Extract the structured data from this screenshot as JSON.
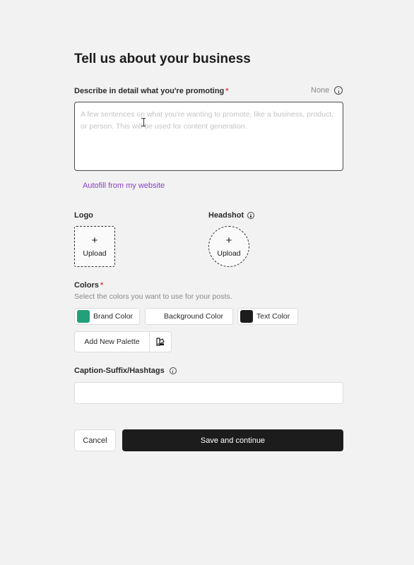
{
  "title": "Tell us about your business",
  "description": {
    "label": "Describe in detail what you're promoting",
    "required_mark": "*",
    "none_text": "None",
    "placeholder": "A few sentences on what you're wanting to promote, like a business, product, or person. This will be used for content generation.",
    "value": ""
  },
  "autofill_link": "Autofill from my website",
  "logo": {
    "label": "Logo",
    "upload_plus": "+",
    "upload_text": "Upload"
  },
  "headshot": {
    "label": "Headshot",
    "upload_plus": "+",
    "upload_text": "Upload"
  },
  "colors": {
    "label": "Colors",
    "required_mark": "*",
    "subtitle": "Select the colors you want to use for your posts.",
    "chips": [
      {
        "label": "Brand Color",
        "color": "#22a07a"
      },
      {
        "label": "Background Color",
        "color": "#ffffff"
      },
      {
        "label": "Text Color",
        "color": "#1c1c1c"
      }
    ],
    "add_palette": "Add New Palette",
    "palette_icon": "palette-swatch-icon"
  },
  "caption": {
    "label": "Caption-Suffix/Hashtags",
    "value": ""
  },
  "actions": {
    "cancel": "Cancel",
    "save": "Save and continue"
  }
}
